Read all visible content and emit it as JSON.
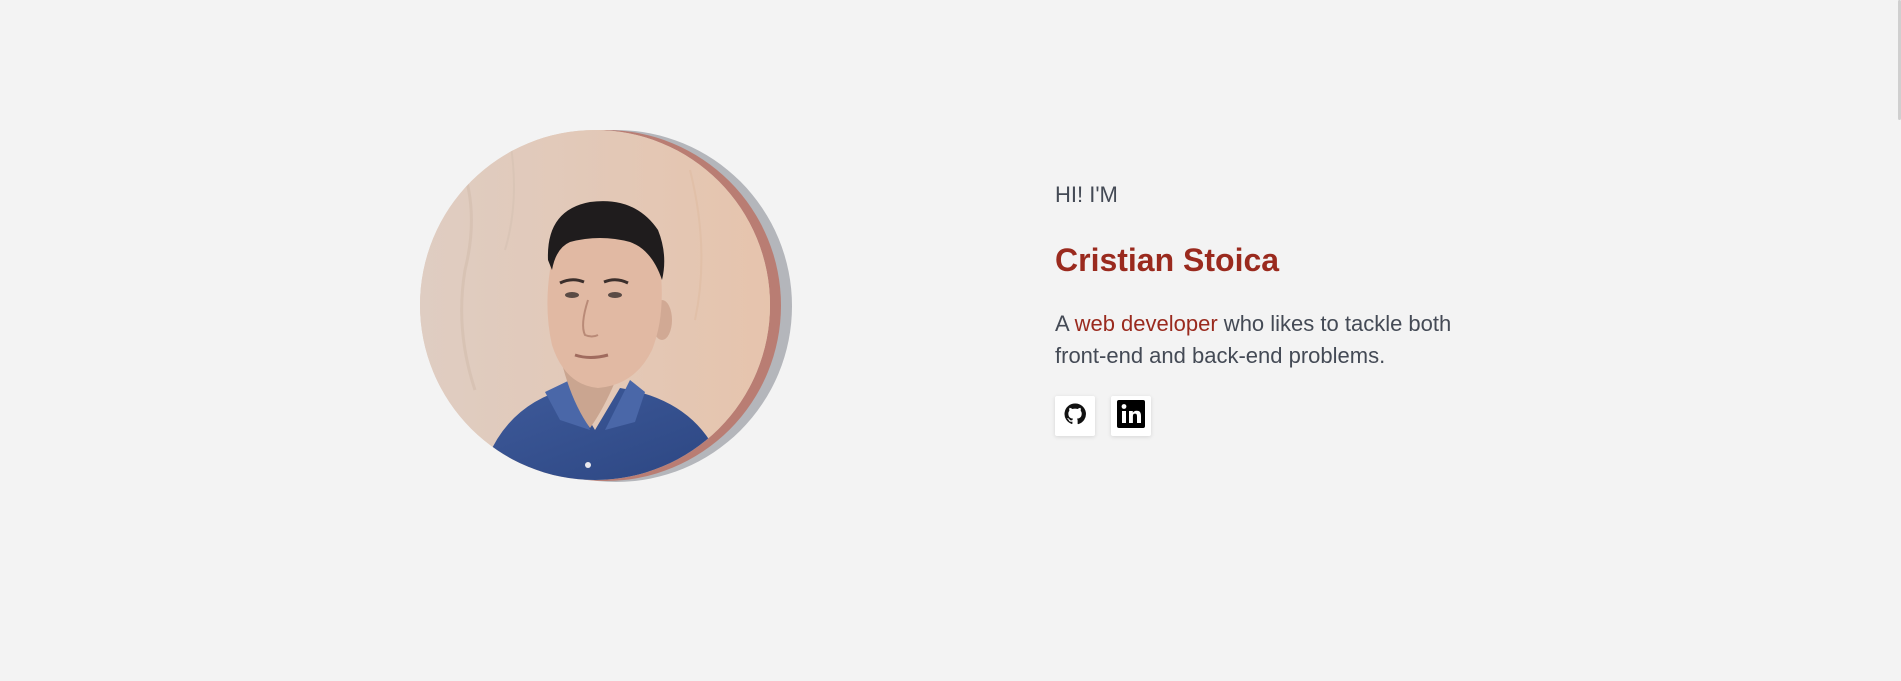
{
  "hero": {
    "greeting": "HI! I'M",
    "name": "Cristian Stoica",
    "tagline_prefix": "A ",
    "tagline_accent": "web developer",
    "tagline_suffix": " who likes to tackle both front-end and back-end problems."
  },
  "socials": [
    {
      "name": "GitHub",
      "icon": "github-icon"
    },
    {
      "name": "LinkedIn",
      "icon": "linkedin-icon"
    }
  ],
  "colors": {
    "background": "#f3f3f3",
    "accent": "#9a2a1e",
    "text": "#444a55",
    "ring_red": "#b97d73",
    "ring_gray": "#b4b6bb"
  }
}
